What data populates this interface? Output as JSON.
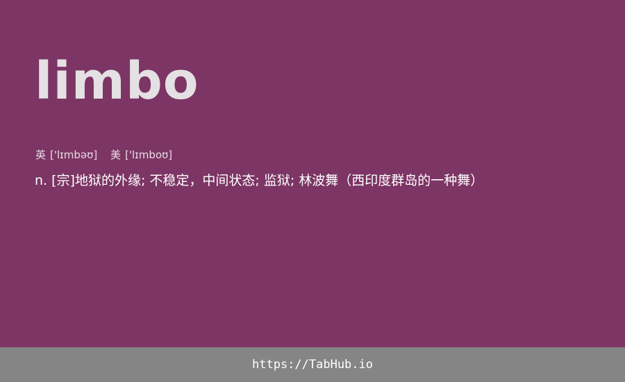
{
  "card": {
    "background": "#7c3564",
    "word": "limbo",
    "phonetics": {
      "uk_label": "英",
      "uk_ipa": "['lɪmbəʊ]",
      "us_label": "美",
      "us_ipa": "['lɪmboʊ]"
    },
    "definition": "n. [宗]地狱的外缘; 不稳定，中间状态; 监狱; 林波舞（西印度群岛的一种舞）"
  },
  "footer": {
    "background": "#858585",
    "link_text": "https://TabHub.io"
  }
}
